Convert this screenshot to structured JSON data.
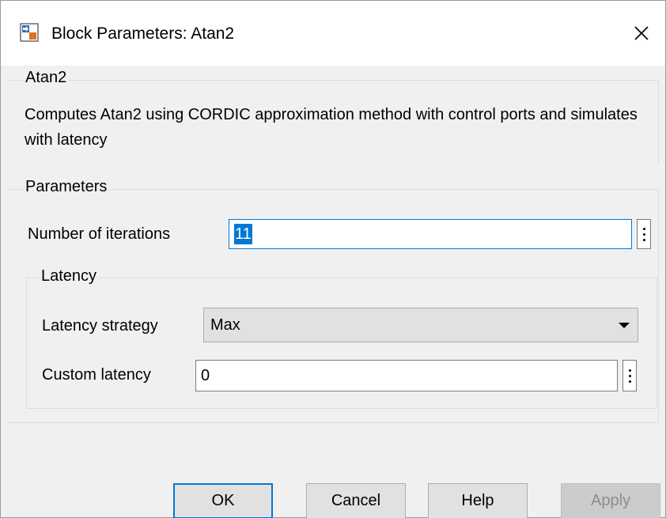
{
  "window": {
    "title": "Block Parameters: Atan2",
    "icon": "simulink-block-icon",
    "close_icon": "close-icon"
  },
  "block_group": {
    "title": "Atan2",
    "description": "Computes Atan2 using CORDIC approximation method with control ports and simulates with latency"
  },
  "parameters": {
    "title": "Parameters",
    "iterations_label": "Number of iterations",
    "iterations_value": "11",
    "latency": {
      "title": "Latency",
      "strategy_label": "Latency strategy",
      "strategy_value": "Max",
      "custom_label": "Custom latency",
      "custom_value": "0"
    }
  },
  "buttons": {
    "ok": "OK",
    "cancel": "Cancel",
    "help": "Help",
    "apply": "Apply"
  },
  "colors": {
    "accent": "#0078d7",
    "window_bg": "#f0f0f0"
  }
}
